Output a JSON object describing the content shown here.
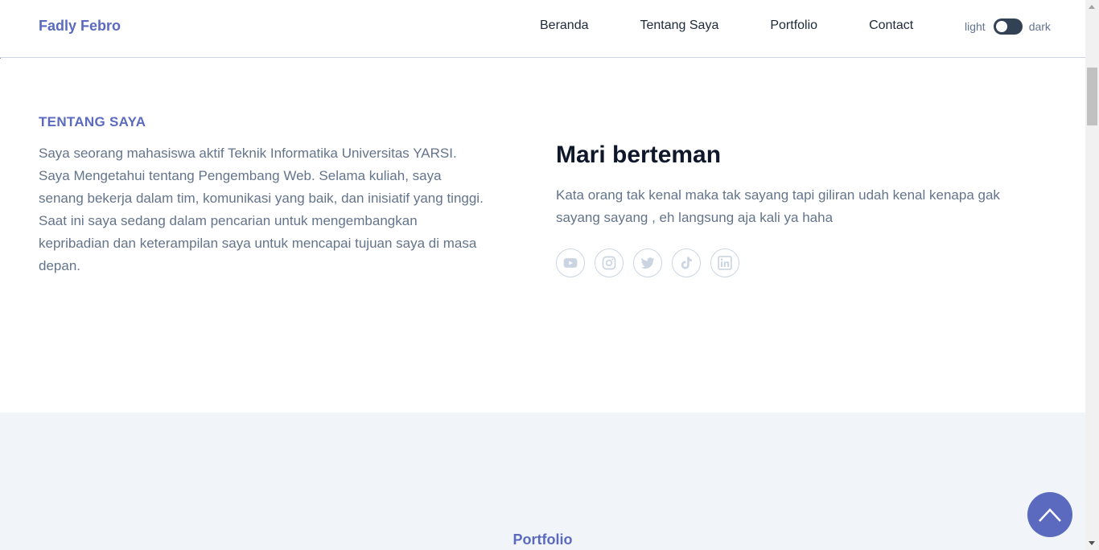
{
  "nav": {
    "brand": "Fadly Febro",
    "links": [
      "Beranda",
      "Tentang Saya",
      "Portfolio",
      "Contact"
    ],
    "theme_light": "light",
    "theme_dark": "dark"
  },
  "about": {
    "eyebrow": "TENTANG SAYA",
    "text": "Saya seorang mahasiswa aktif Teknik Informatika Universitas YARSI. Saya Mengetahui tentang Pengembang Web. Selama kuliah, saya senang bekerja dalam tim, komunikasi yang baik, dan inisiatif yang tinggi. Saat ini saya sedang dalam pencarian untuk mengembangkan kepribadian dan keterampilan saya untuk mencapai tujuan saya di masa depan.",
    "friend_title": "Mari berteman",
    "friend_text": "Kata orang tak kenal maka tak sayang tapi giliran udah kenal kenapa gak sayang sayang , eh langsung aja kali ya haha",
    "socials": [
      "youtube-icon",
      "instagram-icon",
      "twitter-icon",
      "tiktok-icon",
      "linkedin-icon"
    ]
  },
  "portfolio": {
    "eyebrow": "Portfolio"
  },
  "colors": {
    "accent": "#5b6abf",
    "heading": "#0f172a",
    "body_text": "#64748b",
    "section_alt_bg": "#f1f5f9",
    "icon_gray": "#cbd5e1"
  }
}
